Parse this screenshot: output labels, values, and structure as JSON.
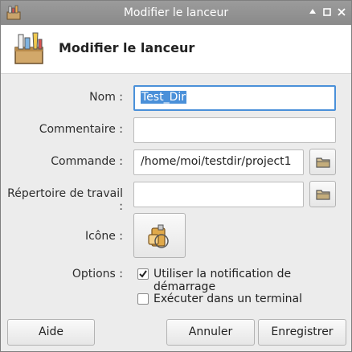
{
  "window": {
    "title": "Modifier le lanceur",
    "controls": [
      "arrow-up-icon",
      "maximize-icon",
      "close-icon"
    ]
  },
  "header": {
    "heading": "Modifier le lanceur",
    "icon": "launcher-tools-icon"
  },
  "form": {
    "name_label": "Nom :",
    "name_value": "Test_Dir",
    "comment_label": "Commentaire :",
    "comment_value": "",
    "command_label": "Commande :",
    "command_value": "/home/moi/testdir/project1",
    "workdir_label": "Répertoire de travail :",
    "workdir_value": "",
    "icon_label": "Icône :",
    "icon_name": "package-icon",
    "options_label": "Options :",
    "startup_notification_label": "Utiliser la notification de démarrage",
    "startup_notification_checked": true,
    "terminal_label": "Exécuter dans un terminal",
    "terminal_checked": false
  },
  "buttons": {
    "help": "Aide",
    "cancel": "Annuler",
    "save": "Enregistrer"
  },
  "colors": {
    "accent": "#4a90d9",
    "titlebar": "#8f8f8f"
  }
}
